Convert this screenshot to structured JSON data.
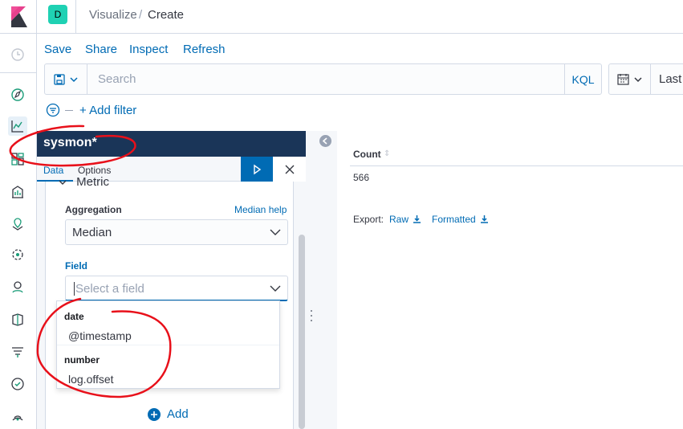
{
  "header": {
    "space_initial": "D",
    "breadcrumbs": [
      "Visualize",
      "Create"
    ],
    "separator": "/"
  },
  "top_nav": {
    "items": [
      "Save",
      "Share",
      "Inspect",
      "Refresh"
    ]
  },
  "query_bar": {
    "search_placeholder": "Search",
    "language_label": "KQL",
    "date_label": "Last"
  },
  "filter_bar": {
    "add_filter_label": "+ Add filter"
  },
  "editor": {
    "title": "sysmon*",
    "tabs": [
      "Data",
      "Options"
    ],
    "metric_heading": "Metric",
    "aggregation_label": "Aggregation",
    "aggregation_help": "Median help",
    "aggregation_value": "Median",
    "field_label": "Field",
    "field_placeholder": "Select a field",
    "field_options": [
      {
        "group": "date",
        "options": [
          "@timestamp"
        ]
      },
      {
        "group": "number",
        "options": [
          "log.offset"
        ]
      }
    ],
    "add_label": "Add"
  },
  "results": {
    "column_header": "Count",
    "value": "566",
    "export_label": "Export:",
    "export_raw": "Raw",
    "export_formatted": "Formatted"
  },
  "colors": {
    "accent": "#006bb4",
    "title_bar": "#1a3558",
    "annotation": "#e8101a",
    "space_badge": "#1fd1b3"
  }
}
